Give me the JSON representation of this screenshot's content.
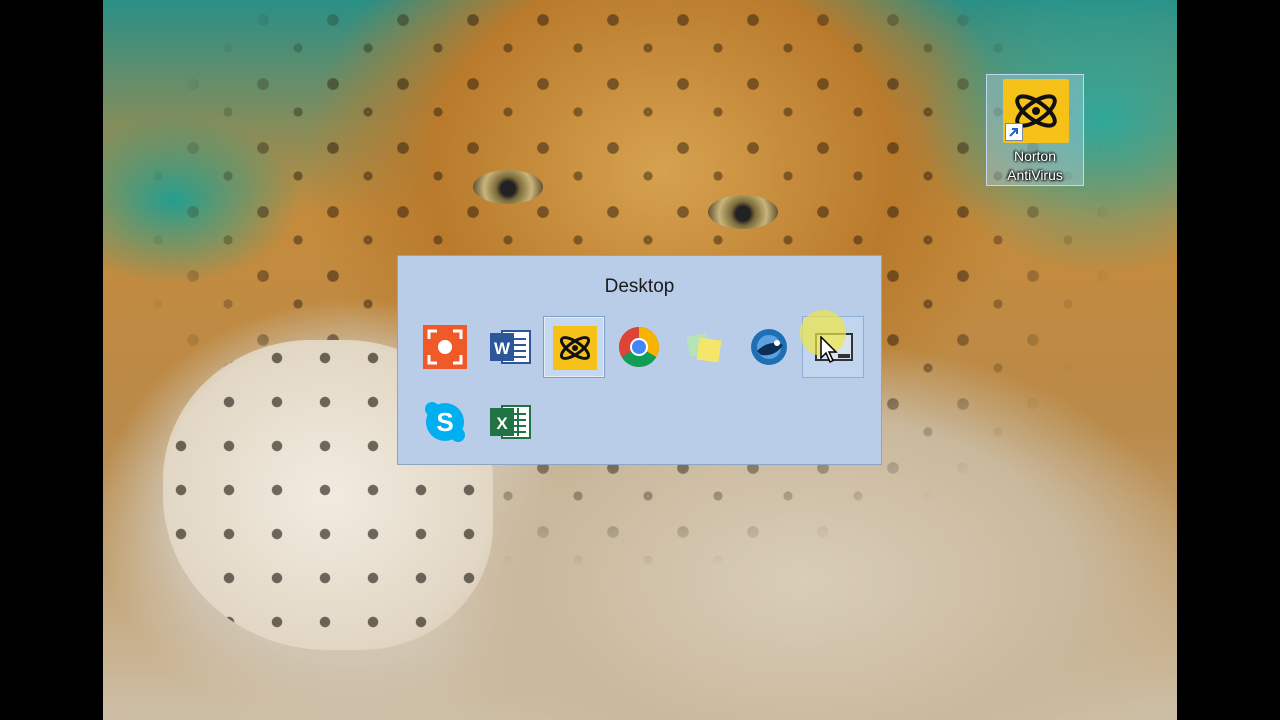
{
  "desktop": {
    "shortcut": {
      "label_line1": "Norton",
      "label_line2": "AntiVirus",
      "icon": "norton-antivirus-icon",
      "tile_color": "#f6c21a"
    }
  },
  "flyout": {
    "title": "Desktop",
    "apps": [
      {
        "name": "screen-capture-app",
        "icon": "orange-capture-icon",
        "color": "#f05a28"
      },
      {
        "name": "word-app",
        "icon": "word-icon",
        "color": "#2b579a"
      },
      {
        "name": "norton-app",
        "icon": "norton-antivirus-icon",
        "color": "#f6c21a",
        "selected": true
      },
      {
        "name": "chrome-app",
        "icon": "chrome-icon"
      },
      {
        "name": "sticky-notes-app",
        "icon": "sticky-notes-icon",
        "color": "#f5e56b"
      },
      {
        "name": "thunderbird-app",
        "icon": "thunderbird-icon",
        "color": "#1f6fb5"
      },
      {
        "name": "show-desktop-app",
        "icon": "show-desktop-icon",
        "hover": true
      },
      {
        "name": "skype-app",
        "icon": "skype-icon",
        "color": "#00aff0"
      },
      {
        "name": "excel-app",
        "icon": "excel-icon",
        "color": "#217346"
      }
    ]
  }
}
